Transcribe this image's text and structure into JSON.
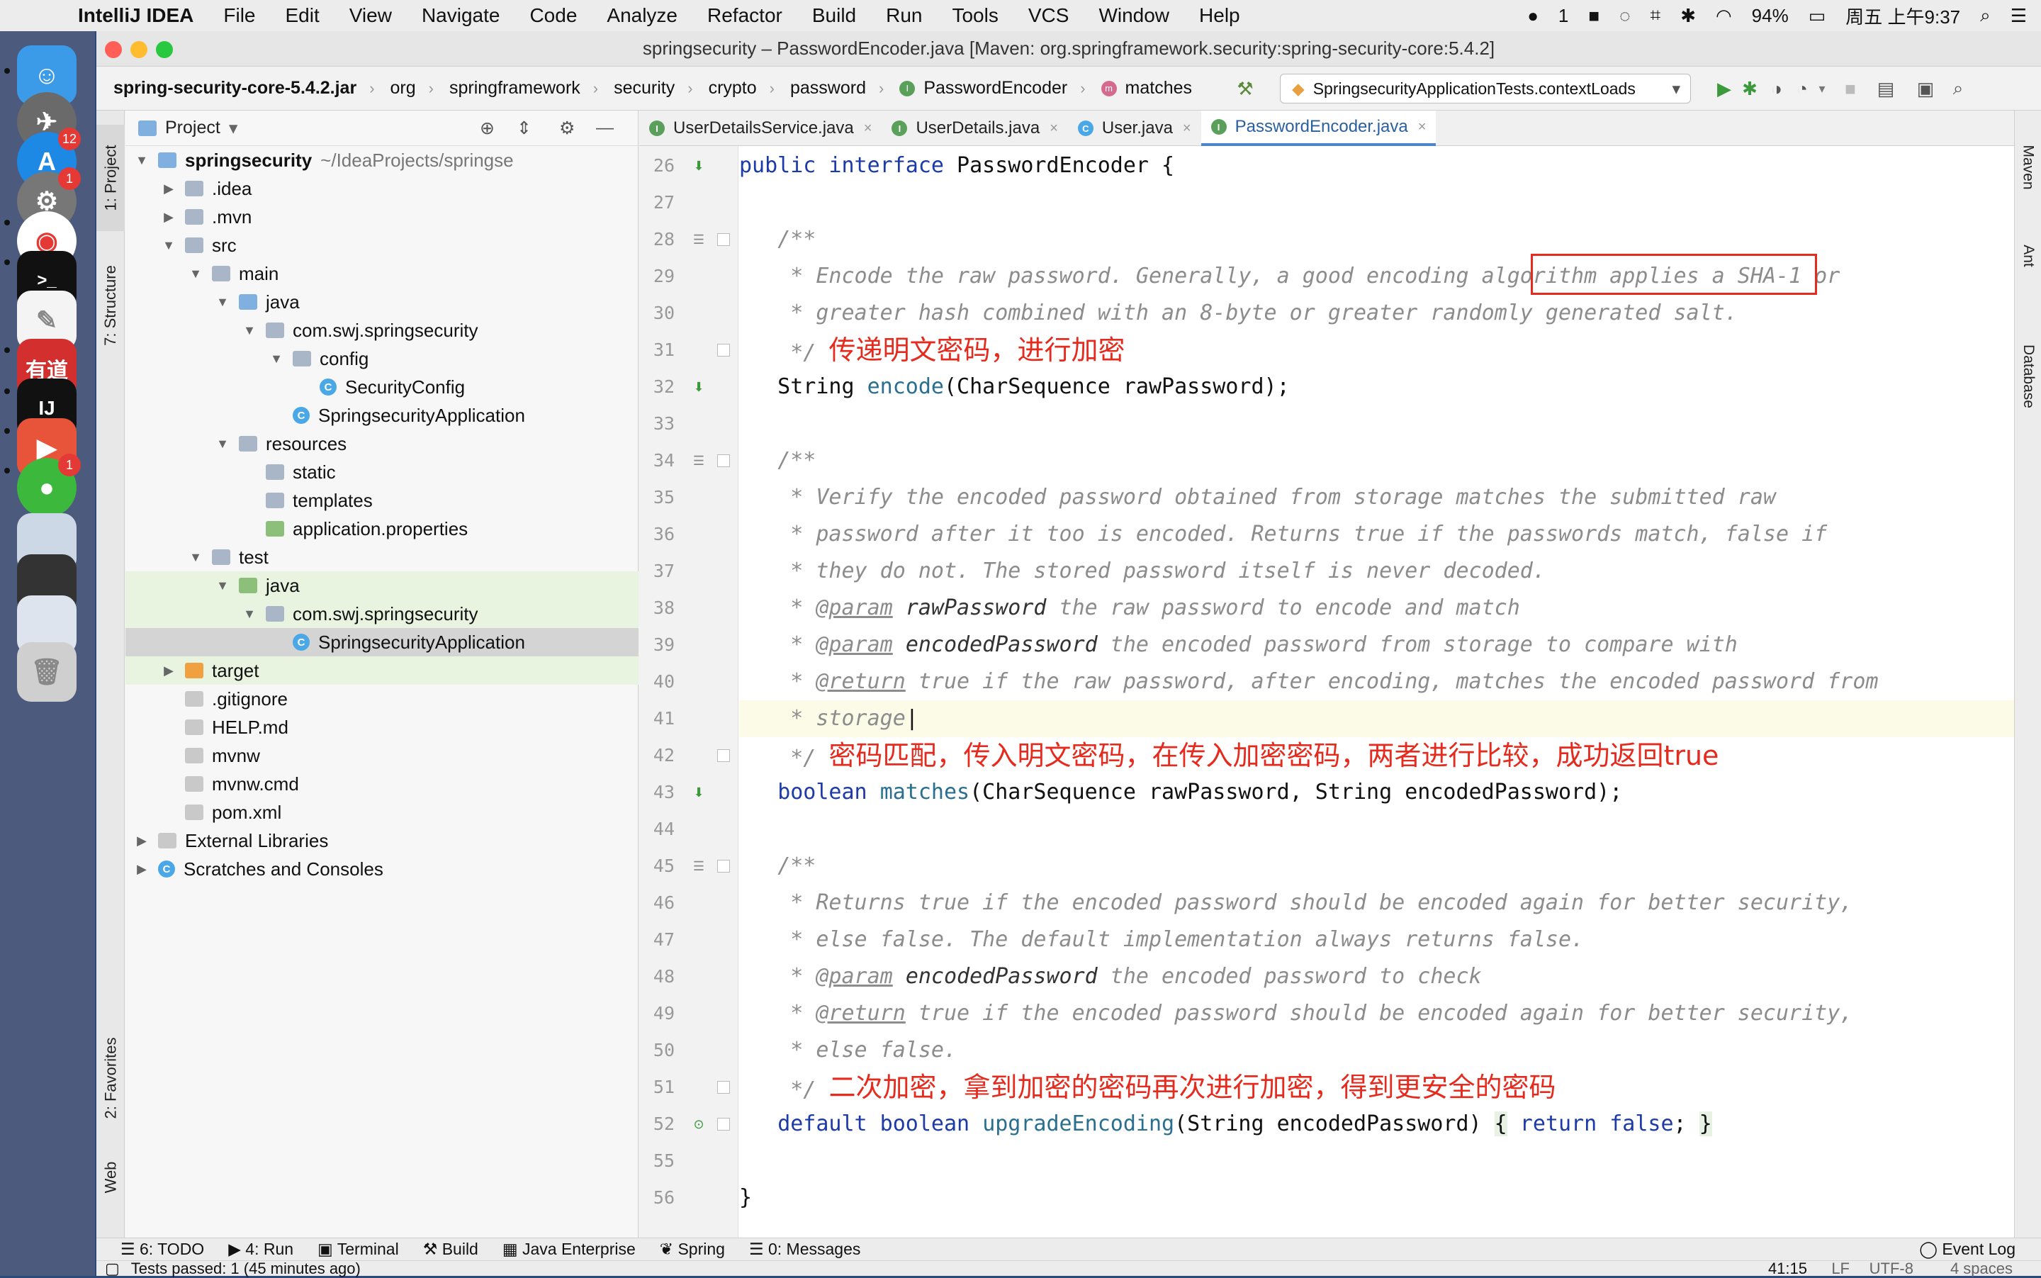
{
  "menubar": {
    "app": "IntelliJ IDEA",
    "items": [
      "File",
      "Edit",
      "View",
      "Navigate",
      "Code",
      "Analyze",
      "Refactor",
      "Build",
      "Run",
      "Tools",
      "VCS",
      "Window",
      "Help"
    ],
    "wechat_count": "1",
    "battery": "94%",
    "clock": "周五 上午9:37"
  },
  "dock": {
    "badges": {
      "appstore": "12",
      "settings": "1",
      "wechat": "1"
    },
    "youdao_label": "有道",
    "ij_label": "IJ"
  },
  "window": {
    "title": "springsecurity – PasswordEncoder.java [Maven: org.springframework.security:spring-security-core:5.4.2]"
  },
  "navbar": {
    "crumbs": [
      "spring-security-core-5.4.2.jar",
      "org",
      "springframework",
      "security",
      "crypto",
      "password",
      "PasswordEncoder",
      "matches"
    ],
    "run_config": "SpringsecurityApplicationTests.contextLoads"
  },
  "left_tabs": [
    "1: Project",
    "7: Structure",
    "2: Favorites",
    "Web"
  ],
  "right_tabs": [
    "Maven",
    "Ant",
    "Database"
  ],
  "project": {
    "header": "Project",
    "tree": [
      {
        "label": "springsecurity",
        "extra": "~/IdeaProjects/springse",
        "depth": 0,
        "tw": "▼",
        "icon": "fold blue",
        "bold": true
      },
      {
        "label": ".idea",
        "depth": 1,
        "tw": "▶",
        "icon": "fold"
      },
      {
        "label": ".mvn",
        "depth": 1,
        "tw": "▶",
        "icon": "fold"
      },
      {
        "label": "src",
        "depth": 1,
        "tw": "▼",
        "icon": "fold"
      },
      {
        "label": "main",
        "depth": 2,
        "tw": "▼",
        "icon": "fold"
      },
      {
        "label": "java",
        "depth": 3,
        "tw": "▼",
        "icon": "fold blue"
      },
      {
        "label": "com.swj.springsecurity",
        "depth": 4,
        "tw": "▼",
        "icon": "fold"
      },
      {
        "label": "config",
        "depth": 5,
        "tw": "▼",
        "icon": "fold"
      },
      {
        "label": "SecurityConfig",
        "depth": 6,
        "tw": "",
        "icon": "cls"
      },
      {
        "label": "SpringsecurityApplication",
        "depth": 5,
        "tw": "",
        "icon": "cls"
      },
      {
        "label": "resources",
        "depth": 3,
        "tw": "▼",
        "icon": "fold"
      },
      {
        "label": "static",
        "depth": 4,
        "tw": "",
        "icon": "fold"
      },
      {
        "label": "templates",
        "depth": 4,
        "tw": "",
        "icon": "fold"
      },
      {
        "label": "application.properties",
        "depth": 4,
        "tw": "",
        "icon": "fold green"
      },
      {
        "label": "test",
        "depth": 2,
        "tw": "▼",
        "icon": "fold"
      },
      {
        "label": "java",
        "depth": 3,
        "tw": "▼",
        "icon": "fold green",
        "hl": true
      },
      {
        "label": "com.swj.springsecurity",
        "depth": 4,
        "tw": "▼",
        "icon": "fold",
        "hl": true
      },
      {
        "label": "SpringsecurityApplication",
        "depth": 5,
        "tw": "",
        "icon": "cls",
        "sel": true
      },
      {
        "label": "target",
        "depth": 1,
        "tw": "▶",
        "icon": "fold orange",
        "hl": true
      },
      {
        "label": ".gitignore",
        "depth": 1,
        "tw": "",
        "icon": "file"
      },
      {
        "label": "HELP.md",
        "depth": 1,
        "tw": "",
        "icon": "file"
      },
      {
        "label": "mvnw",
        "depth": 1,
        "tw": "",
        "icon": "file"
      },
      {
        "label": "mvnw.cmd",
        "depth": 1,
        "tw": "",
        "icon": "file"
      },
      {
        "label": "pom.xml",
        "depth": 1,
        "tw": "",
        "icon": "file"
      },
      {
        "label": "External Libraries",
        "depth": 0,
        "tw": "▶",
        "icon": "file"
      },
      {
        "label": "Scratches and Consoles",
        "depth": 0,
        "tw": "▶",
        "icon": "cls"
      }
    ]
  },
  "tabs": [
    {
      "label": "UserDetailsService.java",
      "icon": "I",
      "color": "#5aa05a"
    },
    {
      "label": "UserDetails.java",
      "icon": "I",
      "color": "#5aa05a"
    },
    {
      "label": "User.java",
      "icon": "C",
      "color": "#4aa8e6"
    },
    {
      "label": "PasswordEncoder.java",
      "icon": "I",
      "color": "#5aa05a",
      "active": true
    }
  ],
  "code": {
    "lines": [
      {
        "n": "26",
        "html": "<span class=\"kw\">public interface</span> PasswordEncoder {"
      },
      {
        "n": "27",
        "html": ""
      },
      {
        "n": "28",
        "html": "   <span class=\"cm\">/**</span>"
      },
      {
        "n": "29",
        "html": "   <span class=\"cm\"> * Encode the raw password. Generally, a good encoding algorithm applies a SHA-1 or</span>"
      },
      {
        "n": "30",
        "html": "   <span class=\"cm\"> * greater hash combined with an 8-byte or greater randomly generated salt.</span>"
      },
      {
        "n": "31",
        "html": "   <span class=\"cm\"> */</span> <span class=\"red\">传递明文密码，进行加密</span>"
      },
      {
        "n": "32",
        "html": "   String <span class=\"fn\">encode</span>(CharSequence rawPassword);"
      },
      {
        "n": "33",
        "html": ""
      },
      {
        "n": "34",
        "html": "   <span class=\"cm\">/**</span>"
      },
      {
        "n": "35",
        "html": "   <span class=\"cm\"> * Verify the encoded password obtained from storage matches the submitted raw</span>"
      },
      {
        "n": "36",
        "html": "   <span class=\"cm\"> * password after it too is encoded. Returns true if the passwords match, false if</span>"
      },
      {
        "n": "37",
        "html": "   <span class=\"cm\"> * they do not. The stored password itself is never decoded.</span>"
      },
      {
        "n": "38",
        "html": "   <span class=\"cm\"> * </span><span class=\"tag\">@param</span> <span class=\"pn\">rawPassword</span><span class=\"cm\"> the raw password to encode and match</span>"
      },
      {
        "n": "39",
        "html": "   <span class=\"cm\"> * </span><span class=\"tag\">@param</span> <span class=\"pn\">encodedPassword</span><span class=\"cm\"> the encoded password from storage to compare with</span>"
      },
      {
        "n": "40",
        "html": "   <span class=\"cm\"> * </span><span class=\"tag\">@return</span><span class=\"cm\"> true if the raw password, after encoding, matches the encoded password from</span>"
      },
      {
        "n": "41",
        "html": "   <span class=\"cm\"> * storage</span>|",
        "cur": true
      },
      {
        "n": "42",
        "html": "   <span class=\"cm\"> */</span> <span class=\"red\">密码匹配，传入明文密码，在传入加密密码，两者进行比较，成功返回true</span>"
      },
      {
        "n": "43",
        "html": "   <span class=\"kw\">boolean</span> <span class=\"fn\">matches</span>(CharSequence rawPassword, String encodedPassword);"
      },
      {
        "n": "44",
        "html": ""
      },
      {
        "n": "45",
        "html": "   <span class=\"cm\">/**</span>"
      },
      {
        "n": "46",
        "html": "   <span class=\"cm\"> * Returns true if the encoded password should be encoded again for better security,</span>"
      },
      {
        "n": "47",
        "html": "   <span class=\"cm\"> * else false. The default implementation always returns false.</span>"
      },
      {
        "n": "48",
        "html": "   <span class=\"cm\"> * </span><span class=\"tag\">@param</span> <span class=\"pn\">encodedPassword</span><span class=\"cm\"> the encoded password to check</span>"
      },
      {
        "n": "49",
        "html": "   <span class=\"cm\"> * </span><span class=\"tag\">@return</span><span class=\"cm\"> true if the encoded password should be encoded again for better security,</span>"
      },
      {
        "n": "50",
        "html": "   <span class=\"cm\"> * else false.</span>"
      },
      {
        "n": "51",
        "html": "   <span class=\"cm\"> */</span> <span class=\"red\">二次加密，拿到加密的密码再次进行加密，得到更安全的密码</span>"
      },
      {
        "n": "52",
        "html": "   <span class=\"kw\">default boolean</span> <span class=\"fn\">upgradeEncoding</span>(String encodedPassword) <span class=\"fold-bg\">{</span> <span class=\"kw\">return false</span>; <span class=\"fold-bg\">}</span>"
      },
      {
        "n": "55",
        "html": ""
      },
      {
        "n": "56",
        "html": "}"
      }
    ]
  },
  "bottombar": {
    "items": [
      "6: TODO",
      "4: Run",
      "Terminal",
      "Build",
      "Java Enterprise",
      "Spring",
      "0: Messages"
    ],
    "event_log": "Event Log"
  },
  "statusbar": {
    "message": "Tests passed: 1 (45 minutes ago)",
    "position": "41:15",
    "line_sep": "LF",
    "encoding": "UTF-8",
    "indent": "4 spaces"
  }
}
